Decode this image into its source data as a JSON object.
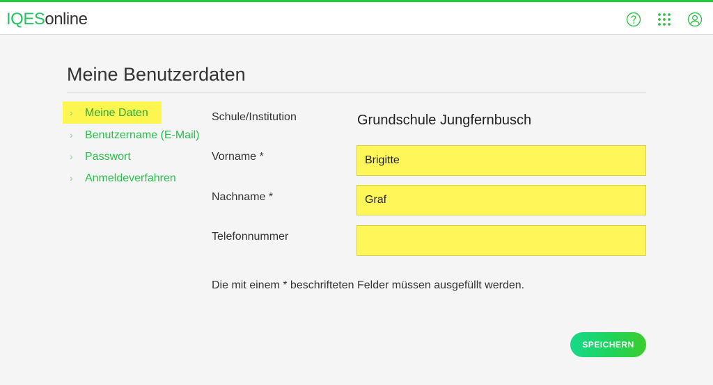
{
  "header": {
    "logo_part1": "IQES",
    "logo_part2": "online",
    "icons": [
      "help-icon",
      "apps-grid-icon",
      "user-account-icon"
    ],
    "accent_color": "#22cc33"
  },
  "page": {
    "title": "Meine Benutzerdaten"
  },
  "subnav": {
    "items": [
      {
        "label": "Meine Daten",
        "active": true
      },
      {
        "label": "Benutzername (E-Mail)",
        "active": false
      },
      {
        "label": "Passwort",
        "active": false
      },
      {
        "label": "Anmeldeverfahren",
        "active": false
      }
    ],
    "chevron": "›"
  },
  "form": {
    "school_label": "Schule/Institution",
    "school_value": "Grundschule Jungfernbusch",
    "firstname_label": "Vorname *",
    "firstname_value": "Brigitte",
    "lastname_label": "Nachname *",
    "lastname_value": "Graf",
    "phone_label": "Telefonnummer",
    "phone_value": "",
    "hint": "Die mit einem * beschrifteten Felder müssen ausgefüllt werden.",
    "save_label": "SPEICHERN",
    "highlight_color": "#fff65a"
  }
}
